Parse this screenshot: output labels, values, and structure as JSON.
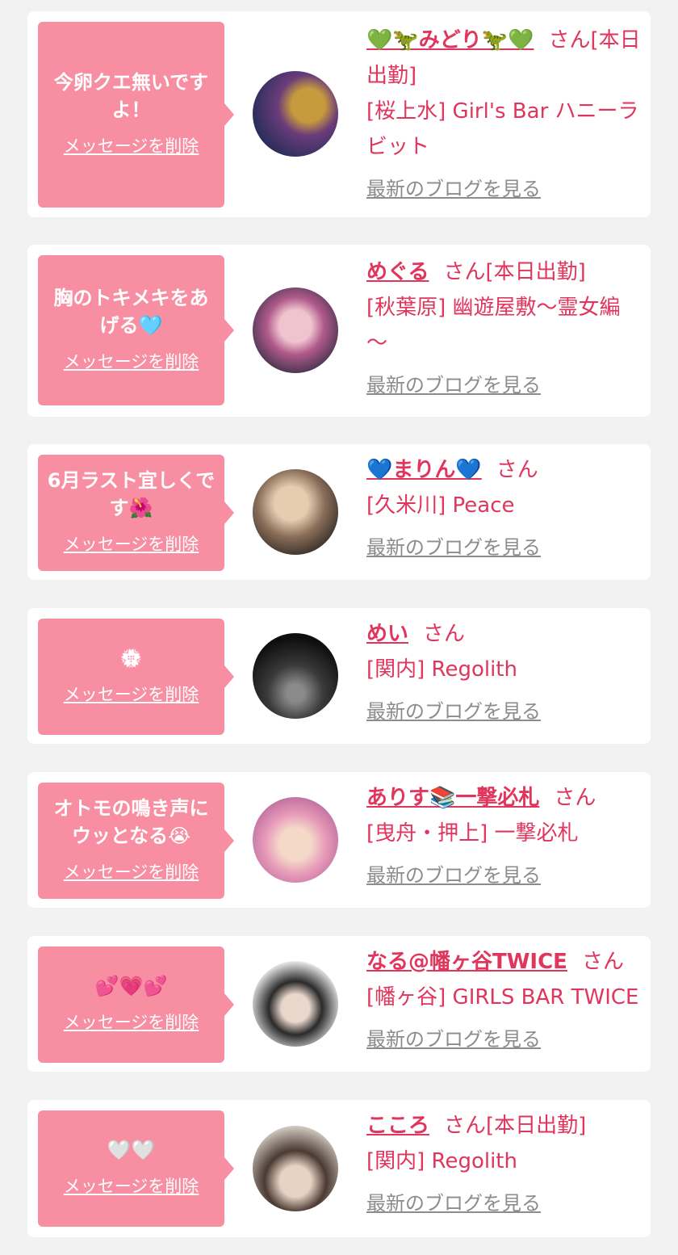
{
  "items": [
    {
      "message": "今卵クエ無いですよ！",
      "delete_label": "メッセージを削除",
      "name": "💚🦖みどり🦖💚",
      "suffix": "さん[本日出勤]",
      "shop": "[桜上水] Girl's Bar ハニーラビット",
      "blog_label": "最新のブログを見る",
      "avatar_colors": [
        "#2b2e5c",
        "#c79a3d"
      ]
    },
    {
      "message": "胸のトキメキをあげる🩵",
      "delete_label": "メッセージを削除",
      "name": "めぐる",
      "suffix": "さん[本日出勤]",
      "shop": "[秋葉原] 幽遊屋敷～霊女編～",
      "blog_label": "最新のブログを見る",
      "avatar_colors": [
        "#3a2f48",
        "#e9b7c6"
      ]
    },
    {
      "message": "6月ラスト宜しくです🌺",
      "delete_label": "メッセージを削除",
      "name": "💙まりん💙",
      "suffix": "さん",
      "shop": "[久米川] Peace",
      "blog_label": "最新のブログを見る",
      "avatar_colors": [
        "#6b5a4a",
        "#d8c3aa"
      ]
    },
    {
      "message": "💮",
      "delete_label": "メッセージを削除",
      "name": "めい",
      "suffix": "さん",
      "shop": "[関内] Regolith",
      "blog_label": "最新のブログを見る",
      "avatar_colors": [
        "#111111",
        "#6a6a6a"
      ]
    },
    {
      "message": "オトモの鳴き声にウッとなる😭",
      "delete_label": "メッセージを削除",
      "name": "ありす📚一撃必札",
      "suffix": "さん",
      "shop": "[曳舟・押上] 一撃必札",
      "blog_label": "最新のブログを見る",
      "avatar_colors": [
        "#e5a4c2",
        "#f4d9c9"
      ]
    },
    {
      "message": "💕💗💕",
      "delete_label": "メッセージを削除",
      "name": "なる@幡ヶ谷TWICE",
      "suffix": "さん",
      "shop": "[幡ヶ谷] GIRLS BAR TWICE",
      "blog_label": "最新のブログを見る",
      "avatar_colors": [
        "#f1f1f1",
        "#2a2a2a"
      ]
    },
    {
      "message": "🤍🤍",
      "delete_label": "メッセージを削除",
      "name": "こころ",
      "suffix": "さん[本日出勤]",
      "shop": "[関内] Regolith",
      "blog_label": "最新のブログを見る",
      "avatar_colors": [
        "#cfc7bd",
        "#4a3a32"
      ]
    }
  ]
}
